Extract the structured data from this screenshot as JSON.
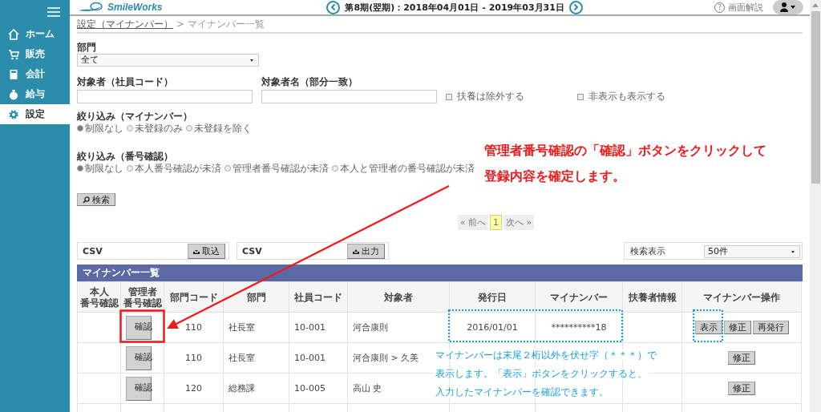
{
  "sidebar": {
    "items": [
      {
        "label": "ホーム",
        "selected": false
      },
      {
        "label": "販売",
        "selected": false
      },
      {
        "label": "会計",
        "selected": false
      },
      {
        "label": "給与",
        "selected": false
      },
      {
        "label": "設定",
        "selected": true
      }
    ]
  },
  "header": {
    "logo": "SmileWorks",
    "period": "第8期(翌期)：2018年04月01日 - 2019年03月31日",
    "help_mark": "?",
    "help": "画面解説"
  },
  "breadcrumb": {
    "link": "設定（マイナンバー）",
    "separator": ">",
    "current": "マイナンバー一覧"
  },
  "department": {
    "label": "部門",
    "value": "全て"
  },
  "code_field": {
    "label": "対象者（社員コード）"
  },
  "name_field": {
    "label": "対象者名（部分一致）"
  },
  "checkboxes": [
    {
      "label": "扶養は除外する",
      "checked": false
    },
    {
      "label": "非表示も表示する",
      "checked": false
    }
  ],
  "filter_mynumber": {
    "label": "絞り込み（マイナンバー）",
    "options": [
      {
        "label": "制限なし",
        "selected": true
      },
      {
        "label": "未登録のみ",
        "selected": false
      },
      {
        "label": "未登録を除く",
        "selected": false
      }
    ]
  },
  "filter_confirm": {
    "label": "絞り込み（番号確認）",
    "options": [
      {
        "label": "制限なし",
        "selected": true
      },
      {
        "label": "本人番号確認が未済",
        "selected": false
      },
      {
        "label": "管理者番号確認が未済",
        "selected": false
      },
      {
        "label": "本人と管理者の番号確認が未済",
        "selected": false
      }
    ]
  },
  "search_button": "検索",
  "pagination": [
    {
      "label": "« 前へ",
      "selected": false
    },
    {
      "label": "1",
      "selected": true
    },
    {
      "label": "次へ »",
      "selected": false
    }
  ],
  "csv_import": {
    "label": "CSV",
    "button": "取込"
  },
  "csv_export": {
    "label": "CSV",
    "button": "出力"
  },
  "display_count": {
    "label": "検索表示",
    "value": "50件"
  },
  "table": {
    "title": "マイナンバー一覧",
    "columns": [
      {
        "lines": [
          "本人",
          "番号確認"
        ]
      },
      {
        "lines": [
          "管理者",
          "番号確認"
        ]
      },
      {
        "lines": [
          "部門コード"
        ]
      },
      {
        "lines": [
          "部門"
        ]
      },
      {
        "lines": [
          "社員コード"
        ]
      },
      {
        "lines": [
          "対象者"
        ]
      },
      {
        "lines": [
          "発行日"
        ]
      },
      {
        "lines": [
          "マイナンバー"
        ]
      },
      {
        "lines": [
          "扶養者情報"
        ]
      },
      {
        "lines": [
          "マイナンバー操作"
        ]
      }
    ],
    "rows": [
      {
        "confirm": "確認",
        "dept_code": "110",
        "dept": "社長室",
        "emp_code": "10-001",
        "person": "河合康則",
        "issued": "2016/01/01",
        "mynumber": "**********18",
        "actions": [
          "表示",
          "修正",
          "再発行"
        ]
      },
      {
        "confirm": "確認",
        "dept_code": "110",
        "dept": "社長室",
        "emp_code": "10-001",
        "person": "河合康則 > 久美",
        "actions": [
          "修正"
        ]
      },
      {
        "confirm": "確認",
        "dept_code": "120",
        "dept": "総務課",
        "emp_code": "10-005",
        "person": "高山 史",
        "actions": [
          "修正"
        ]
      }
    ]
  },
  "annotations": [
    {
      "kind": "red",
      "lines": [
        "管理者番号確認の「確認」ボタンをクリックして",
        "登録内容を確定します。"
      ]
    },
    {
      "kind": "blue",
      "lines": [
        "マイナンバーは末尾２桁以外を伏せ字（＊＊＊）で",
        "表示します。「表示」ボタンをクリックすると、",
        "入力したマイナンバーを確認できます。"
      ]
    }
  ]
}
